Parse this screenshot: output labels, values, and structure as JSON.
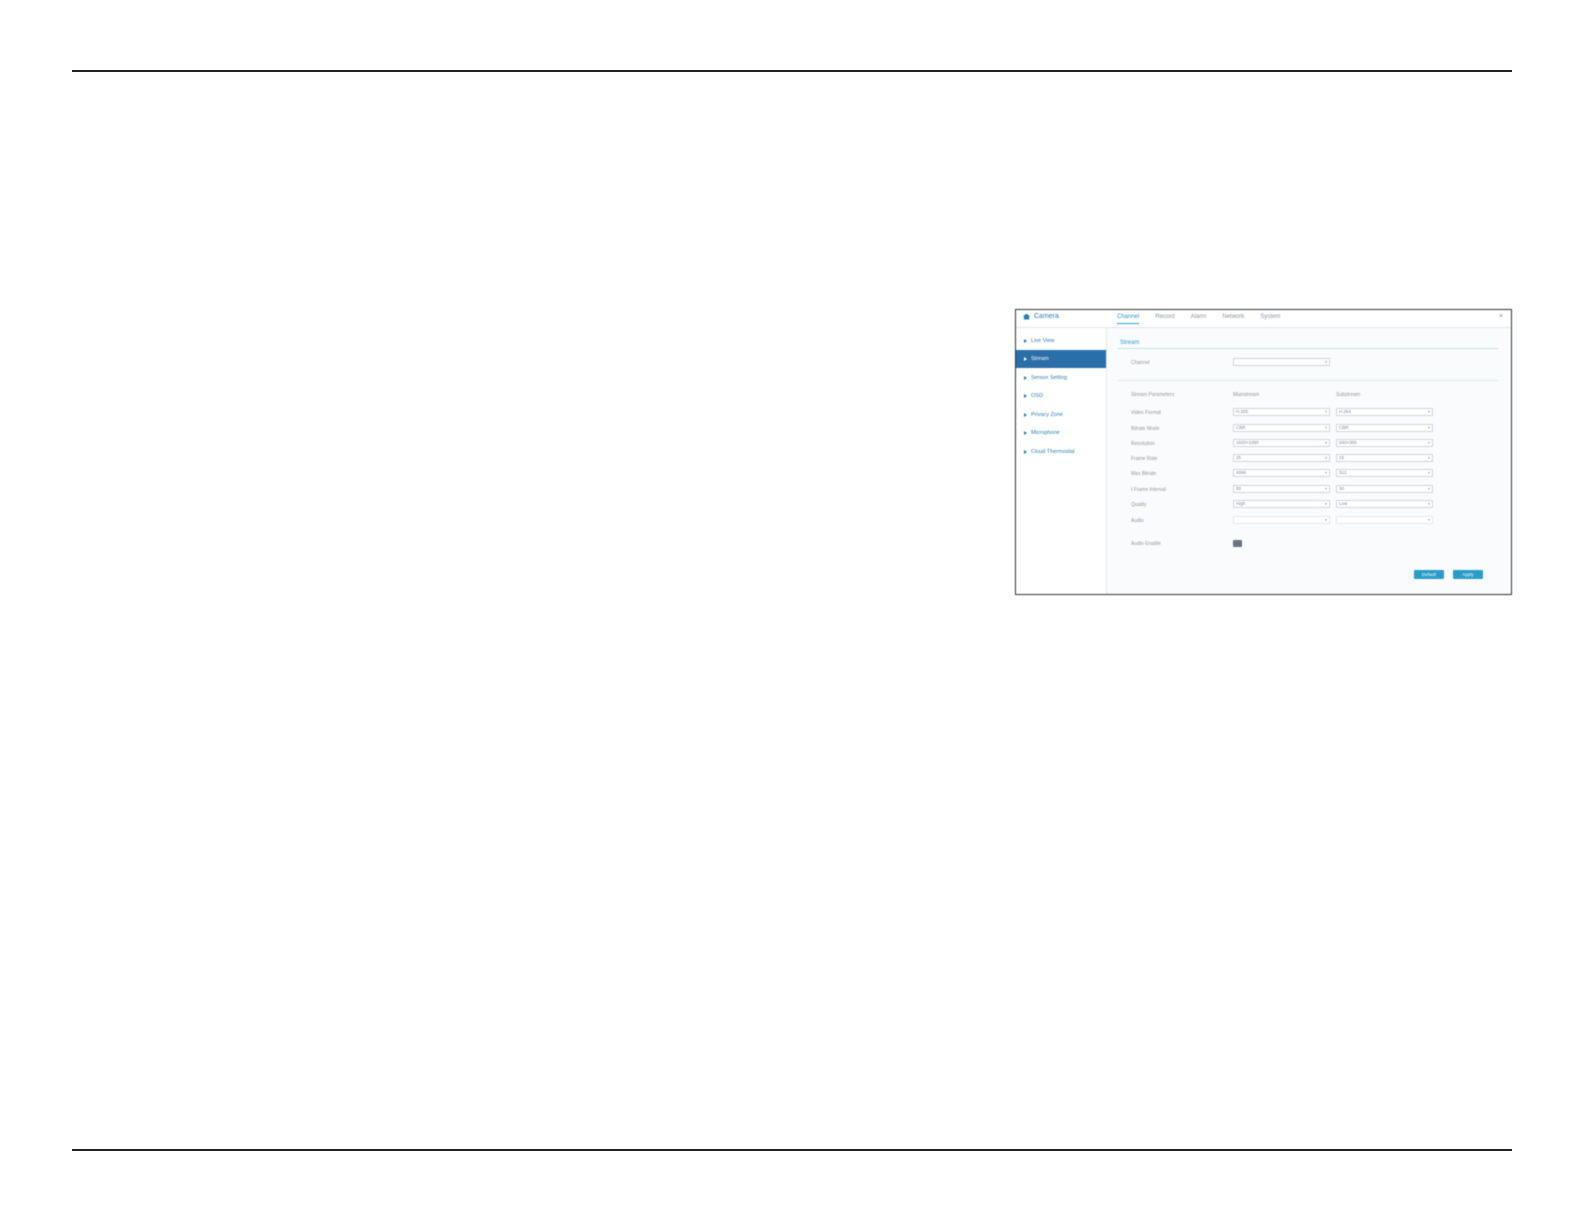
{
  "app": {
    "brand": "Camera"
  },
  "header_tabs": [
    "Channel",
    "Record",
    "Alarm",
    "Network",
    "System"
  ],
  "close_label": "×",
  "sidebar": {
    "items": [
      {
        "label": "Live View",
        "active": false
      },
      {
        "label": "Stream",
        "active": true
      },
      {
        "label": "Sensor Setting",
        "active": false
      },
      {
        "label": "OSD",
        "active": false
      },
      {
        "label": "Privacy Zone",
        "active": false
      },
      {
        "label": "Microphone",
        "active": false
      },
      {
        "label": "Cloud Thermostat",
        "active": false
      }
    ]
  },
  "form": {
    "section_title": "Stream",
    "channel_label": "Channel",
    "channel_value": "",
    "columns": [
      "Mainstream",
      "Substream"
    ],
    "first_col_header": "Stream Parameters",
    "rows": [
      {
        "label": "Video Format",
        "main": "H.265",
        "sub": "H.264"
      },
      {
        "label": "Bitrate Mode",
        "main": "CBR",
        "sub": "CBR"
      },
      {
        "label": "Resolution",
        "main": "1920×1080",
        "sub": "640×360"
      },
      {
        "label": "Frame Rate",
        "main": "25",
        "sub": "15"
      },
      {
        "label": "Max Bitrate",
        "main": "4096",
        "sub": "512"
      },
      {
        "label": "I Frame Interval",
        "main": "50",
        "sub": "30"
      },
      {
        "label": "Quality",
        "main": "High",
        "sub": "Low"
      },
      {
        "label": "Audio",
        "main": "",
        "sub": ""
      }
    ],
    "audio_enable_label": "Audio Enable",
    "buttons": {
      "default": "Default",
      "apply": "Apply"
    }
  },
  "colors": {
    "accent": "#2aa0c8",
    "sidebar_active": "#2a6fa8",
    "page_rule": "#222222"
  }
}
